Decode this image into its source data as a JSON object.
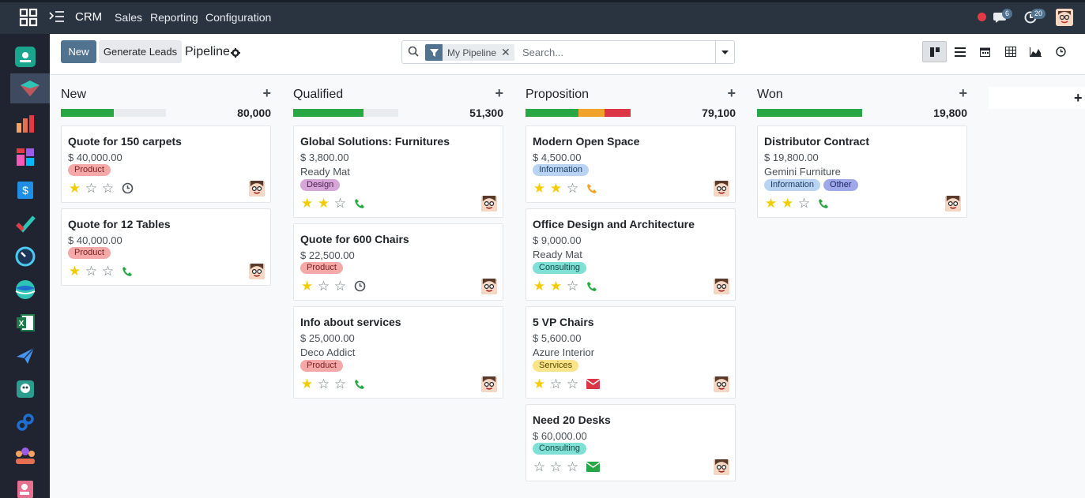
{
  "topbar": {
    "app_name": "CRM",
    "menus": [
      "Sales",
      "Reporting",
      "Configuration"
    ],
    "messages_count": "6",
    "activities_count": "20"
  },
  "control": {
    "new_label": "New",
    "generate_label": "Generate Leads",
    "breadcrumb": "Pipeline",
    "facet_label": "My Pipeline",
    "search_placeholder": "Search..."
  },
  "colors": {
    "green": "#28a745",
    "orange": "#f0a22b",
    "red": "#dc3545",
    "primary": "#52738f"
  },
  "columns": [
    {
      "title": "New",
      "total": "80,000",
      "progress": [
        {
          "color": "#28a745",
          "fraction": 0.5
        }
      ],
      "cards": [
        {
          "title": "Quote for 150 carpets",
          "amount": "$ 40,000.00",
          "company": "",
          "tags": [
            {
              "label": "Product",
              "type": "product"
            }
          ],
          "stars": 1,
          "activity": "clock-icon"
        },
        {
          "title": "Quote for 12 Tables",
          "amount": "$ 40,000.00",
          "company": "",
          "tags": [
            {
              "label": "Product",
              "type": "product"
            }
          ],
          "stars": 1,
          "activity": "phone-icon"
        }
      ]
    },
    {
      "title": "Qualified",
      "total": "51,300",
      "progress": [
        {
          "color": "#28a745",
          "fraction": 0.67
        }
      ],
      "cards": [
        {
          "title": "Global Solutions: Furnitures",
          "amount": "$ 3,800.00",
          "company": "Ready Mat",
          "tags": [
            {
              "label": "Design",
              "type": "design"
            }
          ],
          "stars": 2,
          "activity": "phone-icon"
        },
        {
          "title": "Quote for 600 Chairs",
          "amount": "$ 22,500.00",
          "company": "",
          "tags": [
            {
              "label": "Product",
              "type": "product"
            }
          ],
          "stars": 1,
          "activity": "clock-icon"
        },
        {
          "title": "Info about services",
          "amount": "$ 25,000.00",
          "company": "Deco Addict",
          "tags": [
            {
              "label": "Product",
              "type": "product"
            }
          ],
          "stars": 1,
          "activity": "phone-icon"
        }
      ]
    },
    {
      "title": "Proposition",
      "total": "79,100",
      "progress": [
        {
          "color": "#28a745",
          "fraction": 0.5
        },
        {
          "color": "#f0a22b",
          "fraction": 0.25
        },
        {
          "color": "#dc3545",
          "fraction": 0.25
        }
      ],
      "cards": [
        {
          "title": "Modern Open Space",
          "amount": "$ 4,500.00",
          "company": "",
          "tags": [
            {
              "label": "Information",
              "type": "information"
            }
          ],
          "stars": 2,
          "activity": "phone-orange-icon"
        },
        {
          "title": "Office Design and Architecture",
          "amount": "$ 9,000.00",
          "company": "Ready Mat",
          "tags": [
            {
              "label": "Consulting",
              "type": "consulting"
            }
          ],
          "stars": 2,
          "activity": "phone-icon"
        },
        {
          "title": "5 VP Chairs",
          "amount": "$ 5,600.00",
          "company": "Azure Interior",
          "tags": [
            {
              "label": "Services",
              "type": "services"
            }
          ],
          "stars": 1,
          "activity": "envelope-red-icon"
        },
        {
          "title": "Need 20 Desks",
          "amount": "$ 60,000.00",
          "company": "",
          "tags": [
            {
              "label": "Consulting",
              "type": "consulting"
            }
          ],
          "stars": 0,
          "activity": "envelope-green-icon"
        }
      ]
    },
    {
      "title": "Won",
      "total": "19,800",
      "progress": [
        {
          "color": "#28a745",
          "fraction": 1.0
        }
      ],
      "cards": [
        {
          "title": "Distributor Contract",
          "amount": "$ 19,800.00",
          "company": "Gemini Furniture",
          "tags": [
            {
              "label": "Information",
              "type": "information"
            },
            {
              "label": "Other",
              "type": "other"
            }
          ],
          "stars": 2,
          "activity": "phone-icon"
        }
      ]
    }
  ]
}
